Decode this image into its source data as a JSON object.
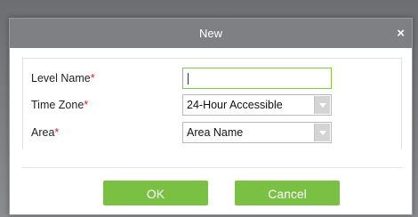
{
  "dialog": {
    "title": "New",
    "close_glyph": "×"
  },
  "form": {
    "level_name": {
      "label": "Level Name",
      "required_mark": "*",
      "value": ""
    },
    "time_zone": {
      "label": "Time Zone",
      "required_mark": "*",
      "selected": "24-Hour Accessible"
    },
    "area": {
      "label": "Area",
      "required_mark": "*",
      "selected": "Area Name"
    }
  },
  "buttons": {
    "ok_label": "OK",
    "cancel_label": "Cancel"
  },
  "colors": {
    "titlebar": "#7e8083",
    "button_green": "#7ac143",
    "required": "#e02020",
    "focus_border": "#8bc34a"
  },
  "icons": {
    "close": "close-icon",
    "dropdown": "chevron-down-icon"
  }
}
